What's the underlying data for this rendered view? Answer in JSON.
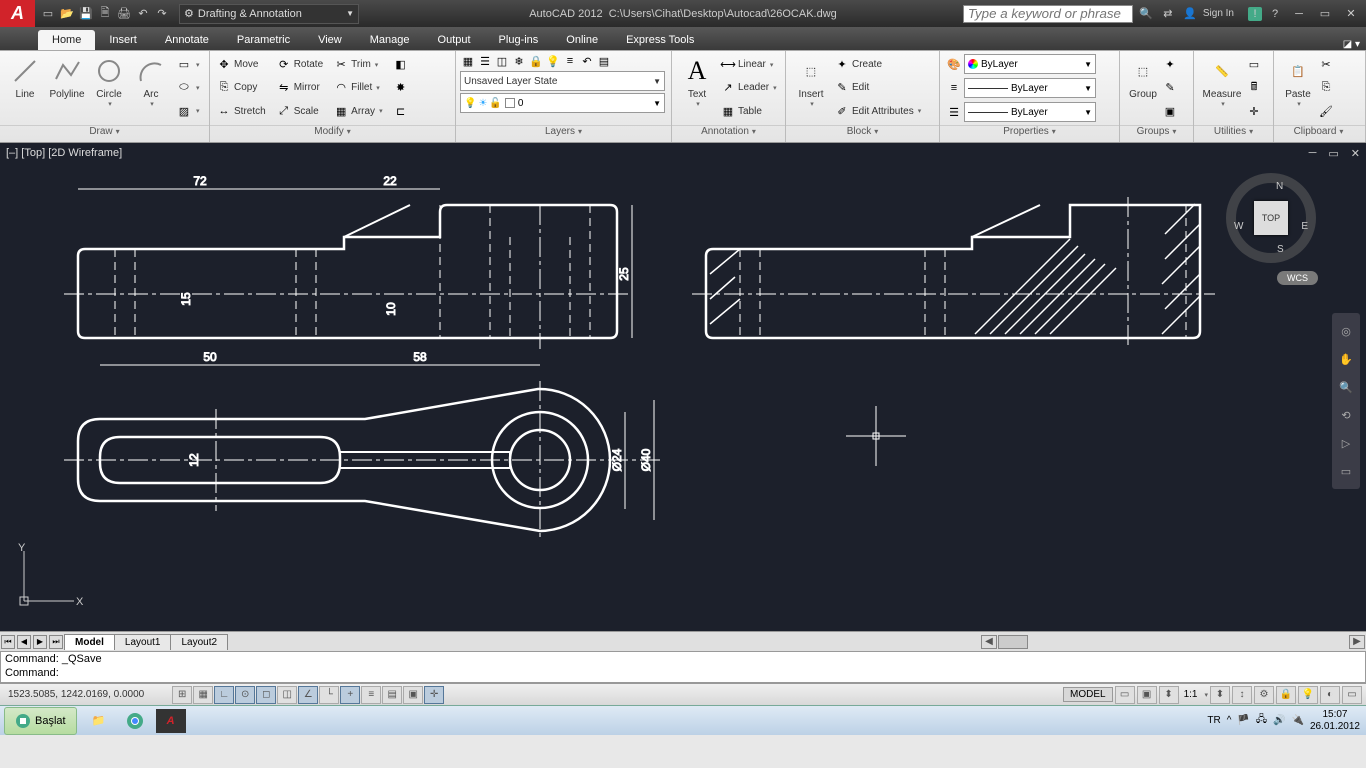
{
  "title": {
    "app": "AutoCAD 2012",
    "path": "C:\\Users\\Cihat\\Desktop\\Autocad\\26OCAK.dwg"
  },
  "workspace": "Drafting & Annotation",
  "search_placeholder": "Type a keyword or phrase",
  "signin": "Sign In",
  "menutabs": [
    "Home",
    "Insert",
    "Annotate",
    "Parametric",
    "View",
    "Manage",
    "Output",
    "Plug-ins",
    "Online",
    "Express Tools"
  ],
  "panels": {
    "draw": {
      "title": "Draw",
      "btns": [
        "Line",
        "Polyline",
        "Circle",
        "Arc"
      ]
    },
    "modify": {
      "title": "Modify",
      "rows": [
        [
          "Move",
          "Rotate",
          "Trim"
        ],
        [
          "Copy",
          "Mirror",
          "Fillet"
        ],
        [
          "Stretch",
          "Scale",
          "Array"
        ]
      ]
    },
    "layers": {
      "title": "Layers",
      "state": "Unsaved Layer State",
      "current": "0"
    },
    "annotation": {
      "title": "Annotation",
      "text": "Text",
      "rows": [
        "Linear",
        "Leader",
        "Table"
      ]
    },
    "block": {
      "title": "Block",
      "insert": "Insert",
      "rows": [
        "Create",
        "Edit",
        "Edit Attributes"
      ]
    },
    "properties": {
      "title": "Properties",
      "rows": [
        "ByLayer",
        "ByLayer",
        "ByLayer"
      ]
    },
    "groups": {
      "title": "Groups",
      "btn": "Group"
    },
    "utilities": {
      "title": "Utilities",
      "btn": "Measure"
    },
    "clipboard": {
      "title": "Clipboard",
      "btn": "Paste"
    }
  },
  "viewport": {
    "label": "[–] [Top] [2D Wireframe]",
    "cube": "TOP",
    "wcs": "WCS",
    "dirs": {
      "n": "N",
      "s": "S",
      "e": "E",
      "w": "W"
    }
  },
  "drawing": {
    "dims": {
      "d72": "72",
      "d22": "22",
      "d25": "25",
      "d15": "15",
      "d10": "10",
      "d50": "50",
      "d58": "58",
      "d12": "12",
      "d24": "Ø24",
      "d40": "Ø40"
    }
  },
  "layout_tabs": [
    "Model",
    "Layout1",
    "Layout2"
  ],
  "command": {
    "line1": "Command: _QSave",
    "line2": "Command:"
  },
  "status": {
    "coords": "1523.5085, 1242.0169, 0.0000",
    "model": "MODEL",
    "ratio": "1:1"
  },
  "taskbar": {
    "start": "Başlat",
    "lang": "TR",
    "time": "15:07",
    "date": "26.01.2012"
  }
}
